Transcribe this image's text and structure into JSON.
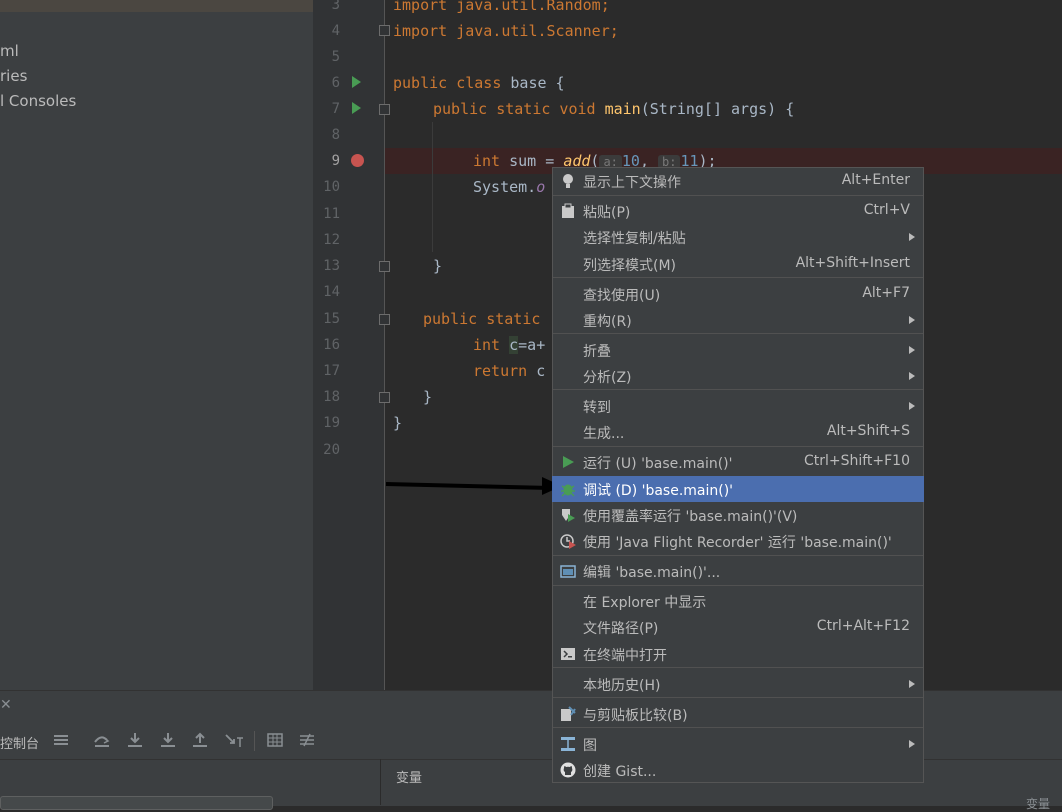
{
  "project_tree": {
    "items": [
      "ml",
      "ries",
      "l Consoles"
    ]
  },
  "gutter": {
    "line_numbers": [
      "3",
      "4",
      "5",
      "6",
      "7",
      "8",
      "9",
      "10",
      "11",
      "12",
      "13",
      "14",
      "15",
      "16",
      "17",
      "18",
      "19",
      "20"
    ]
  },
  "editor": {
    "lines": {
      "l3": "import java.util.Random;",
      "l4": "import java.util.Scanner;",
      "l6_kw": "public class",
      "l6_rest": " base {",
      "l7_kw": "public static void",
      "l7_fn": "main",
      "l7_rest": "(String[] args) {",
      "l9_kw": "int",
      "l9_a": " sum = ",
      "l9_fn": "add",
      "l9_p": "(",
      "l9_h1": "a:",
      "l9_n1": "10",
      "l9_h2": "b:",
      "l9_n2": "11",
      "l9_end": ");",
      "l10_a": "System.",
      "l10_b": "o",
      "l13": "}",
      "l15_kw": "public static",
      "l16_kw": "int",
      "l16_c": "c",
      "l16_rest": "=a+",
      "l17_kw": "return",
      "l17_rest": " c",
      "l18": "}",
      "l19": "}"
    }
  },
  "bottom": {
    "console_label": "控制台",
    "variables_label": "变量",
    "close_glyph": "✕",
    "right_cut_label": "变量"
  },
  "context_menu": {
    "items": [
      {
        "label": "显示上下文操作",
        "shortcut": "Alt+Enter",
        "icon": "lightbulb-icon"
      },
      {
        "label": "粘贴(P)",
        "shortcut": "Ctrl+V",
        "icon": "clipboard-icon"
      },
      {
        "label": "选择性复制/粘贴",
        "shortcut": ""
      },
      {
        "label": "列选择模式(M)",
        "shortcut": "Alt+Shift+Insert"
      },
      {
        "label": "查找使用(U)",
        "shortcut": "Alt+F7"
      },
      {
        "label": "重构(R)",
        "shortcut": ""
      },
      {
        "label": "折叠",
        "shortcut": ""
      },
      {
        "label": "分析(Z)",
        "shortcut": ""
      },
      {
        "label": "转到",
        "shortcut": ""
      },
      {
        "label": "生成...",
        "shortcut": "Alt+Shift+S"
      },
      {
        "label": "运行 (U) 'base.main()'",
        "shortcut": "Ctrl+Shift+F10",
        "icon": "run-icon"
      },
      {
        "label": "调试 (D) 'base.main()'",
        "shortcut": "",
        "icon": "debug-bug-icon"
      },
      {
        "label": "使用覆盖率运行  'base.main()'(V)",
        "shortcut": "",
        "icon": "coverage-run-icon"
      },
      {
        "label": "使用 'Java Flight Recorder' 运行 'base.main()'",
        "shortcut": "",
        "icon": "flight-recorder-icon"
      },
      {
        "label": "编辑 'base.main()'...",
        "shortcut": "",
        "icon": "edit-config-icon"
      },
      {
        "label": "在 Explorer 中显示",
        "shortcut": ""
      },
      {
        "label": "文件路径(P)",
        "shortcut": "Ctrl+Alt+F12"
      },
      {
        "label": "在终端中打开",
        "shortcut": "",
        "icon": "terminal-icon"
      },
      {
        "label": "本地历史(H)",
        "shortcut": ""
      },
      {
        "label": "与剪贴板比较(B)",
        "shortcut": "",
        "icon": "compare-icon"
      },
      {
        "label": "图",
        "shortcut": "",
        "icon": "diagram-icon"
      },
      {
        "label": "创建 Gist...",
        "shortcut": "",
        "icon": "github-icon"
      }
    ]
  },
  "colors": {
    "menu_selection": "#4b6eaf",
    "breakpoint": "#c75450",
    "run_green": "#499c54"
  }
}
